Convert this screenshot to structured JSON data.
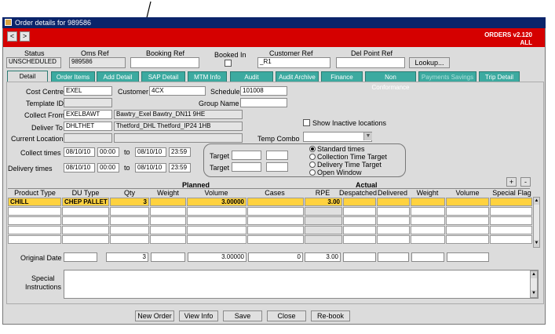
{
  "window": {
    "title": "Order details for 989586"
  },
  "header": {
    "version": "ORDERS v2.120",
    "scope": "ALL",
    "prev_label": "<",
    "next_label": ">"
  },
  "top": {
    "status_label": "Status",
    "status_value": "UNSCHEDULED",
    "oms_ref_label": "Oms Ref",
    "oms_ref_value": "989586",
    "booking_ref_label": "Booking Ref",
    "booking_ref_value": "",
    "booked_in_label": "Booked In",
    "customer_ref_label": "Customer Ref",
    "customer_ref_value": "_R1",
    "del_point_ref_label": "Del Point Ref",
    "del_point_ref_value": "",
    "lookup_label": "Lookup..."
  },
  "tabs": [
    "Detail",
    "Order Items",
    "Add Detail",
    "SAP Detail",
    "MTM Info",
    "Audit",
    "Audit Archive",
    "Finance",
    "Non Conformance",
    "Payments Savings",
    "Trip Detail"
  ],
  "detail": {
    "cost_centre_label": "Cost Centre",
    "cost_centre_value": "EXEL",
    "customer_label": "Customer",
    "customer_value": "4CX",
    "schedule_label": "Schedule",
    "schedule_value": "101008",
    "template_id_label": "Template ID",
    "template_id_value": "",
    "group_name_label": "Group Name",
    "group_name_value": "",
    "collect_from_label": "Collect From",
    "collect_from_code": "EXELBAWT",
    "collect_from_desc": "Bawtry_Exel Bawtry_DN11 9HE",
    "deliver_to_label": "Deliver To",
    "deliver_to_code": "DHLTHET",
    "deliver_to_desc": "Thetford_DHL Thetford_IP24 1HB",
    "show_inactive_label": "Show Inactive locations",
    "current_location_label": "Current Location",
    "current_location_value": "",
    "temp_combo_label": "Temp Combo",
    "temp_combo_value": "",
    "collect_times_label": "Collect times",
    "collect_from_date": "08/10/10",
    "collect_from_time": "00:00",
    "to_label": "to",
    "collect_to_date": "08/10/10",
    "collect_to_time": "23:59",
    "delivery_times_label": "Delivery times",
    "delivery_from_date": "08/10/10",
    "delivery_from_time": "00:00",
    "delivery_to_date": "08/10/10",
    "delivery_to_time": "23:59",
    "target_label_1": "Target",
    "target_label_2": "Target",
    "radio_options": [
      "Standard times",
      "Collection Time Target",
      "Delivery Time Target",
      "Open Window"
    ]
  },
  "grid": {
    "planned_label": "Planned",
    "actual_label": "Actual",
    "add_label": "+",
    "remove_label": "-",
    "columns": [
      "Product Type",
      "DU Type",
      "Qty",
      "Weight",
      "Volume",
      "Cases",
      "RPE",
      "Despatched",
      "Delivered",
      "Weight",
      "Volume",
      "Special Flag"
    ],
    "row1": {
      "product_type": "CHILL",
      "du_type": "CHEP PALLET",
      "qty": "3",
      "volume": "3.00000",
      "rpe": "3.00"
    }
  },
  "totals": {
    "original_date_label": "Original Date",
    "qty": "3",
    "volume": "3.00000",
    "cases": "0",
    "rpe": "3.00"
  },
  "special": {
    "label_line1": "Special",
    "label_line2": "Instructions"
  },
  "footer": {
    "new_order": "New Order",
    "view_info": "View Info",
    "save": "Save",
    "close": "Close",
    "rebook": "Re-book"
  }
}
